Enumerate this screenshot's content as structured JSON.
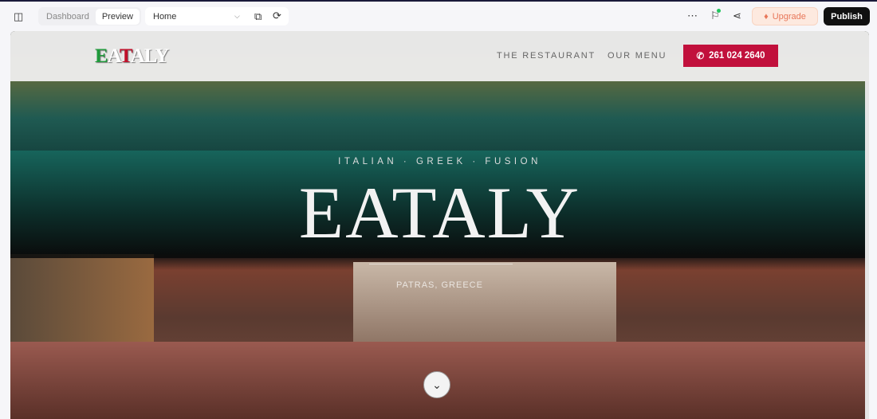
{
  "toolbar": {
    "tabs": [
      {
        "label": "Dashboard"
      },
      {
        "label": "Preview"
      }
    ],
    "page_select": "Home",
    "upgrade_label": "Upgrade",
    "publish_label": "Publish",
    "status_dot_color": "#22c55e"
  },
  "site": {
    "logo": [
      "E",
      "A",
      "T",
      "A",
      "L",
      "Y"
    ],
    "nav": [
      {
        "label": "THE RESTAURANT"
      },
      {
        "label": "OUR MENU"
      }
    ],
    "phone": "261 024 2640",
    "hero": {
      "tagline": "ITALIAN · GREEK · FUSION",
      "title": "EATALY",
      "location": "PATRAS, GREECE"
    },
    "accent": "#c1103c"
  }
}
